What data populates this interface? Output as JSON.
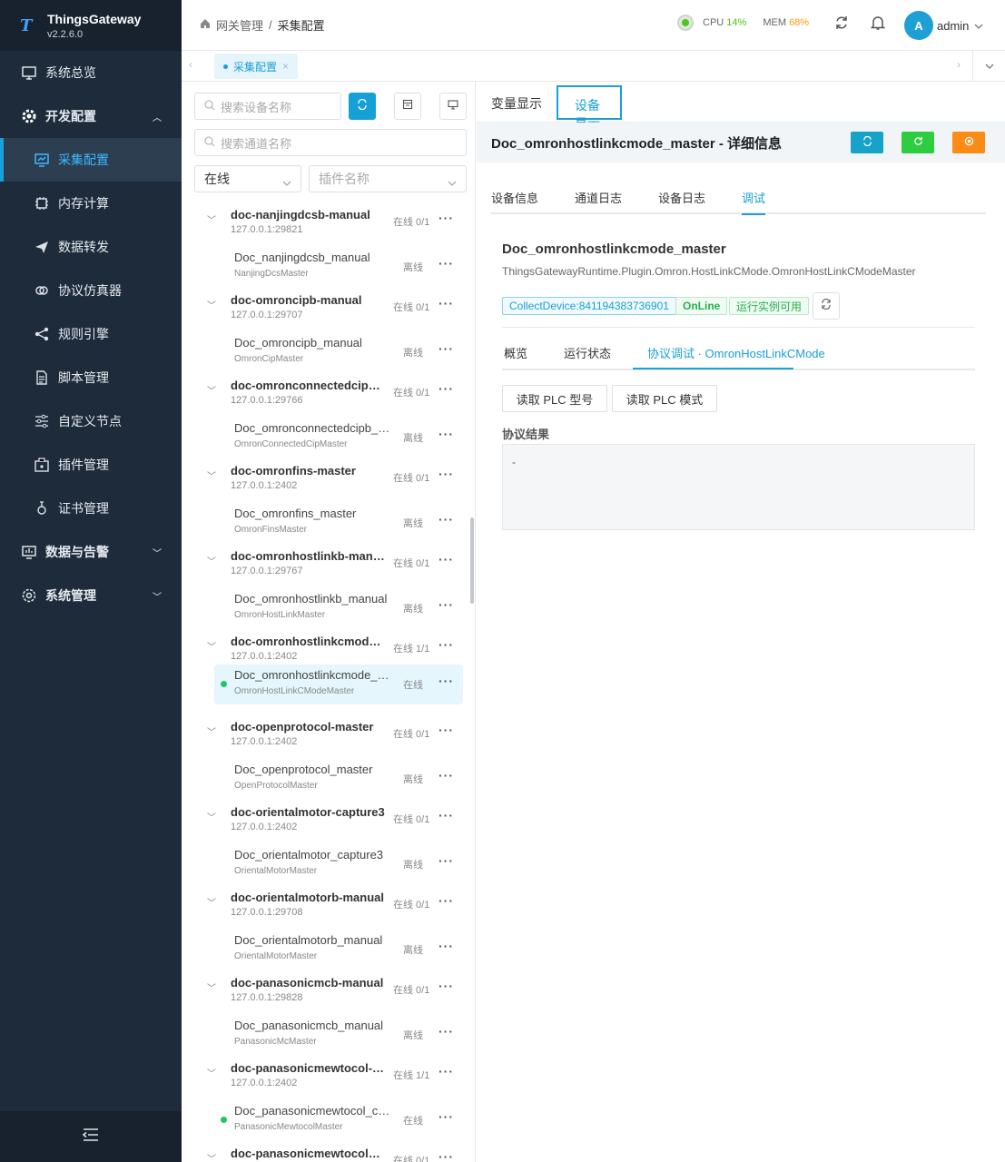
{
  "app": {
    "name": "ThingsGateway",
    "version": "v2.2.6.0"
  },
  "sidebar": {
    "items": [
      {
        "label": "系统总览",
        "icon": "monitor-icon"
      },
      {
        "label": "开发配置",
        "icon": "gear-icon"
      },
      {
        "label": "采集配置",
        "icon": "collect-icon"
      },
      {
        "label": "内存计算",
        "icon": "chip-icon"
      },
      {
        "label": "数据转发",
        "icon": "send-icon"
      },
      {
        "label": "协议仿真器",
        "icon": "link-icon"
      },
      {
        "label": "规则引擎",
        "icon": "share-icon"
      },
      {
        "label": "脚本管理",
        "icon": "document-icon"
      },
      {
        "label": "自定义节点",
        "icon": "sliders-icon"
      },
      {
        "label": "插件管理",
        "icon": "package-icon"
      },
      {
        "label": "证书管理",
        "icon": "certificate-icon"
      },
      {
        "label": "数据与告警",
        "icon": "chart-icon"
      },
      {
        "label": "系统管理",
        "icon": "settings-icon"
      }
    ]
  },
  "header": {
    "breadcrumb": [
      "网关管理",
      "采集配置"
    ],
    "cpu_label": "CPU",
    "cpu_value": "14%",
    "mem_label": "MEM",
    "mem_value": "68%",
    "avatar_letter": "A",
    "user": "admin"
  },
  "tabs": {
    "open_tab": "采集配置",
    "close": "×"
  },
  "left": {
    "search_device_placeholder": "搜索设备名称",
    "search_channel_placeholder": "搜索通道名称",
    "status_filter": "在线",
    "plugin_filter_placeholder": "插件名称",
    "channels": [
      {
        "name": "doc-nanjingdcsb-manual",
        "addr": "127.0.0.1:29821",
        "status": "在线 0/1",
        "device": "Doc_nanjingdcsb_manual",
        "plugin": "NanjingDcsMaster",
        "dstatus": "离线"
      },
      {
        "name": "doc-omroncipb-manual",
        "addr": "127.0.0.1:29707",
        "status": "在线 0/1",
        "device": "Doc_omroncipb_manual",
        "plugin": "OmronCipMaster",
        "dstatus": "离线"
      },
      {
        "name": "doc-omronconnectedcipb-...",
        "addr": "127.0.0.1:29766",
        "status": "在线 0/1",
        "device": "Doc_omronconnectedcipb_m...",
        "plugin": "OmronConnectedCipMaster",
        "dstatus": "离线"
      },
      {
        "name": "doc-omronfins-master",
        "addr": "127.0.0.1:2402",
        "status": "在线 0/1",
        "device": "Doc_omronfins_master",
        "plugin": "OmronFinsMaster",
        "dstatus": "离线"
      },
      {
        "name": "doc-omronhostlinkb-manual",
        "addr": "127.0.0.1:29767",
        "status": "在线 0/1",
        "device": "Doc_omronhostlinkb_manual",
        "plugin": "OmronHostLinkMaster",
        "dstatus": "离线"
      },
      {
        "name": "doc-omronhostlinkcmode-...",
        "addr": "127.0.0.1:2402",
        "status": "在线 1/1",
        "device": "Doc_omronhostlinkcmode_m...",
        "plugin": "OmronHostLinkCModeMaster",
        "dstatus": "在线"
      },
      {
        "name": "doc-openprotocol-master",
        "addr": "127.0.0.1:2402",
        "status": "在线 0/1",
        "device": "Doc_openprotocol_master",
        "plugin": "OpenProtocolMaster",
        "dstatus": "离线"
      },
      {
        "name": "doc-orientalmotor-capture3",
        "addr": "127.0.0.1:2402",
        "status": "在线 0/1",
        "device": "Doc_orientalmotor_capture3",
        "plugin": "OrientalMotorMaster",
        "dstatus": "离线"
      },
      {
        "name": "doc-orientalmotorb-manual",
        "addr": "127.0.0.1:29708",
        "status": "在线 0/1",
        "device": "Doc_orientalmotorb_manual",
        "plugin": "OrientalMotorMaster",
        "dstatus": "离线"
      },
      {
        "name": "doc-panasonicmcb-manual",
        "addr": "127.0.0.1:29828",
        "status": "在线 0/1",
        "device": "Doc_panasonicmcb_manual",
        "plugin": "PanasonicMcMaster",
        "dstatus": "离线"
      },
      {
        "name": "doc-panasonicmewtocol-c...",
        "addr": "127.0.0.1:2402",
        "status": "在线 1/1",
        "device": "Doc_panasonicmewtocol_cap...",
        "plugin": "PanasonicMewtocolMaster",
        "dstatus": "在线"
      },
      {
        "name": "doc-panasonicmewtocolb-...",
        "addr": "",
        "status": "在线 0/1",
        "device": "",
        "plugin": "",
        "dstatus": ""
      }
    ]
  },
  "right": {
    "view_tabs": [
      "变量显示",
      "设备显示"
    ],
    "detail_title": "Doc_omronhostlinkcmode_master - 详细信息",
    "inner_tabs": [
      "设备信息",
      "通道日志",
      "设备日志",
      "调试"
    ],
    "device_name": "Doc_omronhostlinkcmode_master",
    "plugin_full": "ThingsGatewayRuntime.Plugin.Omron.HostLinkCMode.OmronHostLinkCModeMaster",
    "tag_collect": "CollectDevice:841194383736901",
    "tag_online": "OnLine",
    "tag_runtime": "运行实例可用",
    "protocol_tabs": [
      "概览",
      "运行状态",
      "协议调试 · OmronHostLinkCMode"
    ],
    "action_read_model": "读取 PLC 型号",
    "action_read_mode": "读取 PLC 模式",
    "result_label": "协议结果",
    "result_value": "-"
  },
  "colors": {
    "accent": "#1a9fd6",
    "green": "#22c55e",
    "orange": "#fa8c16",
    "sidebar_bg": "#1d2b3a"
  }
}
